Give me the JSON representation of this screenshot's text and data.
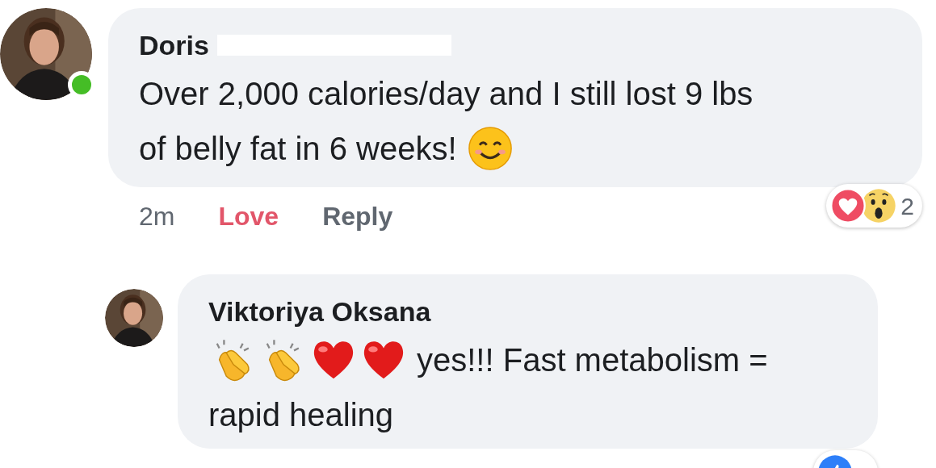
{
  "comments": [
    {
      "author": "Doris",
      "name_redacted": true,
      "online": true,
      "lines": [
        {
          "text": "Over 2,000 calories/day and I still lost 9 lbs"
        },
        {
          "text": "of belly fat in 6 weeks!",
          "emoji_after": [
            {
              "kind": "smile"
            }
          ]
        }
      ],
      "actions": [
        {
          "kind": "time",
          "label": "2m"
        },
        {
          "kind": "reaction",
          "label": "Love",
          "selected": true
        },
        {
          "kind": "reply",
          "label": "Reply"
        }
      ],
      "reactions": [
        {
          "kind": "love"
        },
        {
          "kind": "wow"
        }
      ],
      "reaction_count": "2"
    },
    {
      "author": "Viktoriya Oksana",
      "lines": [
        {
          "emoji_before": [
            {
              "kind": "clap"
            },
            {
              "kind": "clap"
            },
            {
              "kind": "heart"
            },
            {
              "kind": "heart"
            }
          ],
          "text": "yes!!! Fast metabolism ="
        },
        {
          "text": "rapid healing"
        }
      ],
      "reactions": [
        {
          "kind": "like"
        }
      ]
    }
  ]
}
